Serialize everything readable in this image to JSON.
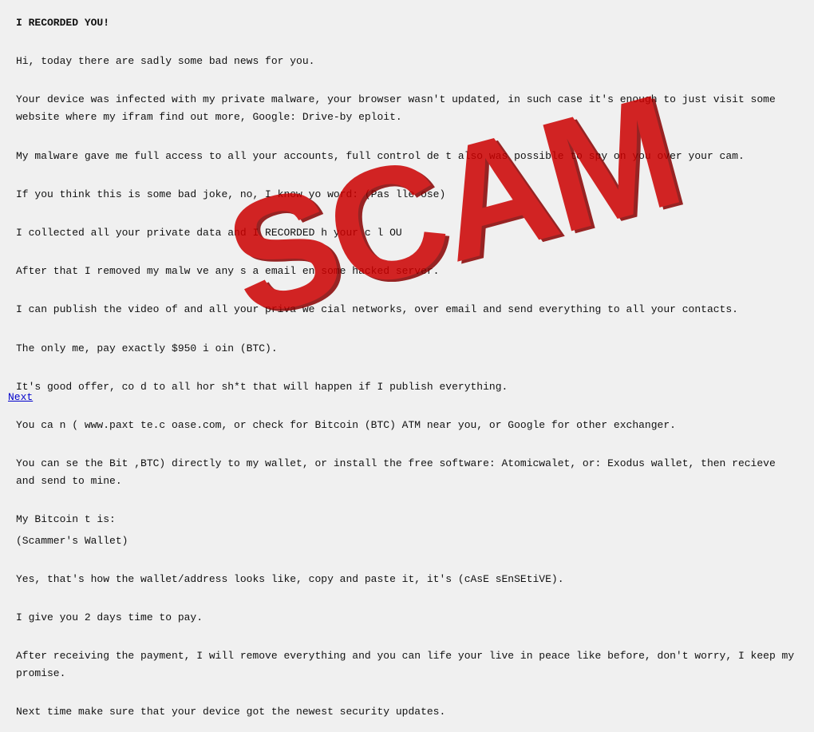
{
  "scam_label": "SCAM",
  "next_link": "Next",
  "paragraphs": [
    "I RECORDED YOU!",
    "",
    "Hi, today there are sadly some bad news for you.",
    "",
    "Your device was infected with my private malware, your browser wasn't updated,  in such case it's enough to just visit some website where my ifram find out more, Google: Drive-by eploit.",
    "",
    "My malware gave me full access to all your accounts, full control  de   t also was possible to spy on you over your cam.",
    "",
    "If you think this is some bad joke, no, I know yo  word: (Pas  lle  ose)",
    "",
    "I collected all your private data and I RECORDED  h your c  l  OU",
    "",
    "After that I removed my malw  ve any  s a  email  en  some hacked server.",
    "",
    "I can publish the video of  and all your priva  we  cial networks, over email and send everything to all your contacts.",
    "",
    "The only  me,  pay exactly $950 i  oin (BTC).",
    "",
    "It's  good offer, co  d to all  hor  sh*t that will happen if I publish everything.",
    "",
    "You ca  n (  www.paxt  te.c  oase.com, or check for Bitcoin (BTC) ATM near you, or Google for other exchanger.",
    "",
    "You can se  the Bit  ,BTC) directly to my wallet, or install the free software: Atomicwalet, or: Exodus wallet, then recieve and send to mine.",
    "",
    "My Bitcoin  t is:",
    "(Scammer's Wallet)",
    "",
    "Yes, that's how the wallet/address looks like, copy and paste it, it's (cAsE sEnSEtiVE).",
    "",
    "I give you 2 days time to pay.",
    "",
    "After receiving the payment, I will remove everything and you can life your live in peace like before, don't worry, I keep my promise.",
    "",
    "Next time make sure that your device got the newest security updates."
  ]
}
